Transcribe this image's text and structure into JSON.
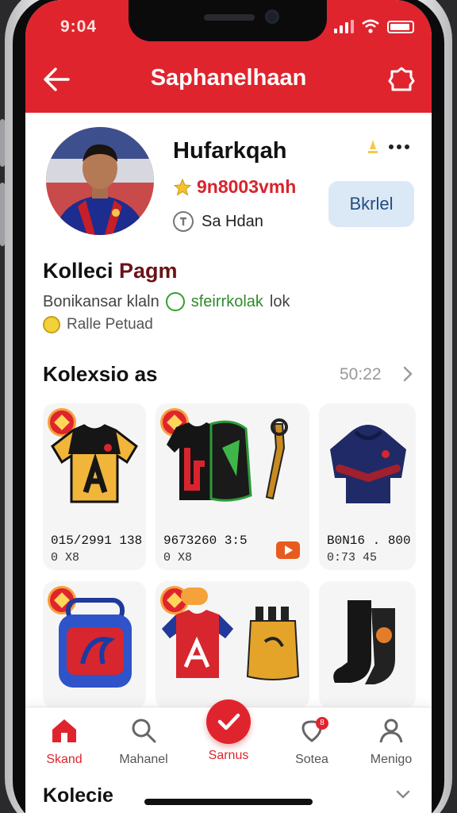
{
  "status_bar": {
    "time": "9:04"
  },
  "header": {
    "title": "Saphanelhaan",
    "back_icon": "arrow-left-icon",
    "action_icon": "badge-icon"
  },
  "profile": {
    "name": "Hufarkqah",
    "rating": "9n8003vmh",
    "location": "Sa Hdan",
    "follow_label": "Bkrlel"
  },
  "collection": {
    "title_part1": "Kolleci ",
    "title_part2": "Pagm",
    "description": "Bonikansar klaln",
    "description_green": "sfeirrkolak",
    "description_tail": "lok",
    "sub": "Ralle Petuad"
  },
  "section": {
    "title": "Kolexsio as",
    "count": "50:22"
  },
  "products": [
    {
      "price": "015/2991 138",
      "qty": "0 X8"
    },
    {
      "price": "9673260 3:5",
      "qty": "0 X8"
    },
    {
      "price": "B0N16 . 800",
      "qty": "0:73 45"
    }
  ],
  "bottom_nav": {
    "items": [
      "Skand",
      "Mahanel",
      "Sarnus",
      "Sotea",
      "Menigo"
    ],
    "active_index": 0,
    "notification_count": "8"
  },
  "footer": {
    "title": "Kolecie"
  },
  "colors": {
    "brand_red": "#e0242d",
    "follow_bg": "#dbe9f7"
  }
}
